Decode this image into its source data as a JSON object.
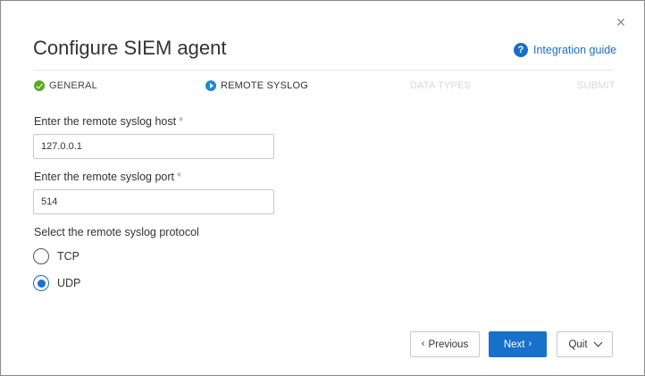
{
  "dialog": {
    "title": "Configure SIEM agent",
    "close_glyph": "×",
    "help_glyph": "?",
    "integration_guide": "Integration guide"
  },
  "steps": [
    {
      "label": "GENERAL",
      "state": "completed"
    },
    {
      "label": "REMOTE SYSLOG",
      "state": "current"
    },
    {
      "label": "DATA TYPES",
      "state": "upcoming"
    },
    {
      "label": "SUBMIT",
      "state": "upcoming"
    }
  ],
  "form": {
    "host_label": "Enter the remote syslog host",
    "host_value": "127.0.0.1",
    "port_label": "Enter the remote syslog port",
    "port_value": "514",
    "required_mark": "*",
    "protocol_label": "Select the remote syslog protocol",
    "protocols": [
      {
        "label": "TCP",
        "checked": false
      },
      {
        "label": "UDP",
        "checked": true
      }
    ]
  },
  "buttons": {
    "previous": "Previous",
    "previous_glyph": "‹",
    "next": "Next",
    "next_glyph": "›",
    "quit": "Quit"
  },
  "colors": {
    "accent": "#1770c9",
    "success": "#5aa821",
    "disabled_text": "#d8d8d8"
  },
  "icons": {
    "close": "close-icon",
    "help": "help-circle-icon",
    "completed_step": "check-circle-icon",
    "current_step": "play-circle-icon",
    "previous": "chevron-left-icon",
    "next": "chevron-right-icon",
    "quit": "chevron-down-icon"
  }
}
